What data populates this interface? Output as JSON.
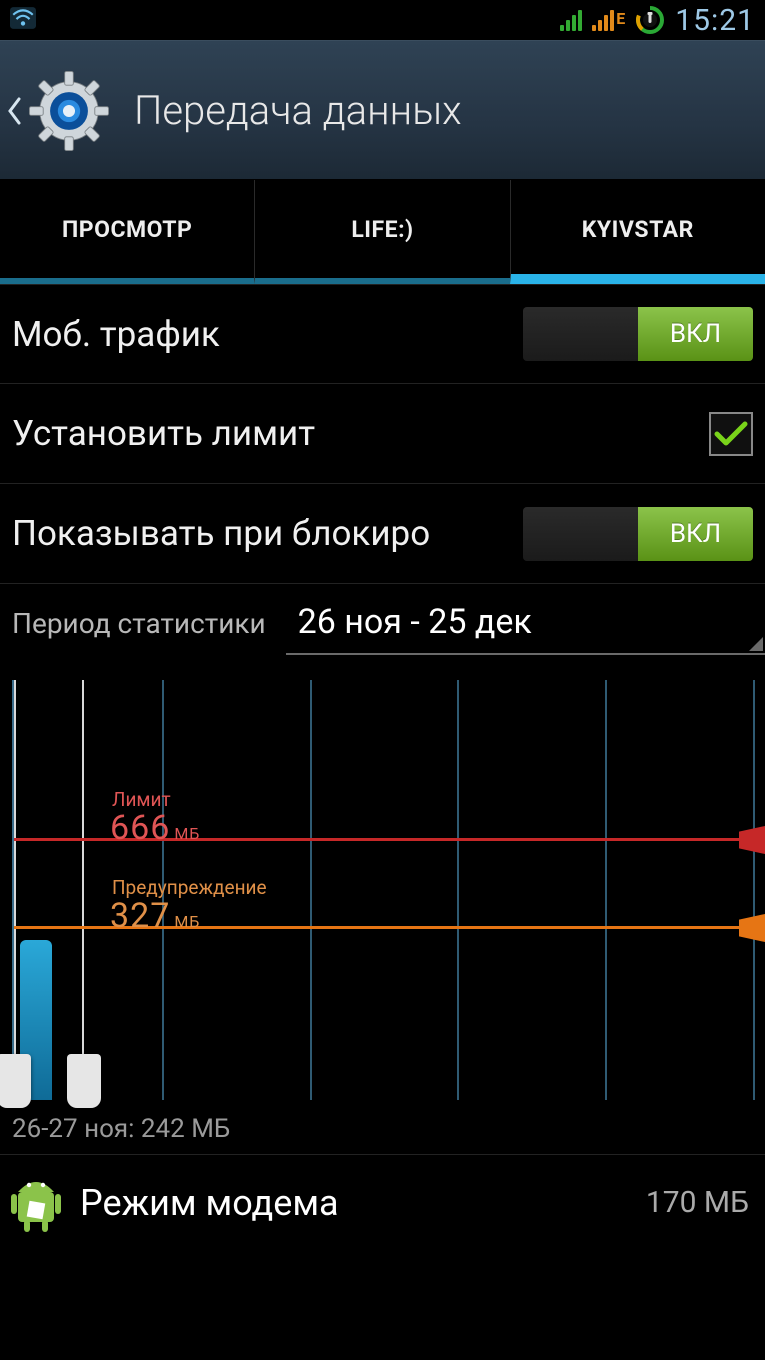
{
  "status": {
    "time": "15:21",
    "network_edge": "E"
  },
  "header": {
    "title": "Передача данных"
  },
  "tabs": [
    {
      "id": "overview",
      "label": "ПРОСМОТР",
      "active": false
    },
    {
      "id": "life",
      "label": "LIFE:)",
      "active": false
    },
    {
      "id": "kyivstar",
      "label": "KYIVSTAR",
      "active": true
    }
  ],
  "settings": {
    "mobile_data": {
      "label": "Моб. трафик",
      "toggle": "ВКЛ"
    },
    "set_limit": {
      "label": "Установить лимит",
      "checked": true
    },
    "show_on_lock": {
      "label": "Показывать при блокиро",
      "toggle": "ВКЛ"
    }
  },
  "period": {
    "label": "Период статистики",
    "value": "26 ноя - 25 дек"
  },
  "chart_data": {
    "type": "bar",
    "title": "",
    "xlabel": "",
    "ylabel": "",
    "x_range": [
      "26 ноя",
      "25 дек"
    ],
    "selected_range": "26-27 ноя",
    "selected_usage_mb": 242,
    "ylim_mb": [
      0,
      900
    ],
    "limit": {
      "label": "Лимит",
      "value": 666,
      "unit": "МБ",
      "color": "#c62828"
    },
    "warning": {
      "label": "Предупреждение",
      "value": 327,
      "unit": "МБ",
      "color": "#e67514"
    },
    "categories": [
      "26-27 ноя"
    ],
    "values": [
      242
    ],
    "grid_columns": 5
  },
  "selection_summary": "26-27 ноя: 242 МБ",
  "apps": [
    {
      "name": "Режим модема",
      "usage": "170 МБ"
    }
  ]
}
